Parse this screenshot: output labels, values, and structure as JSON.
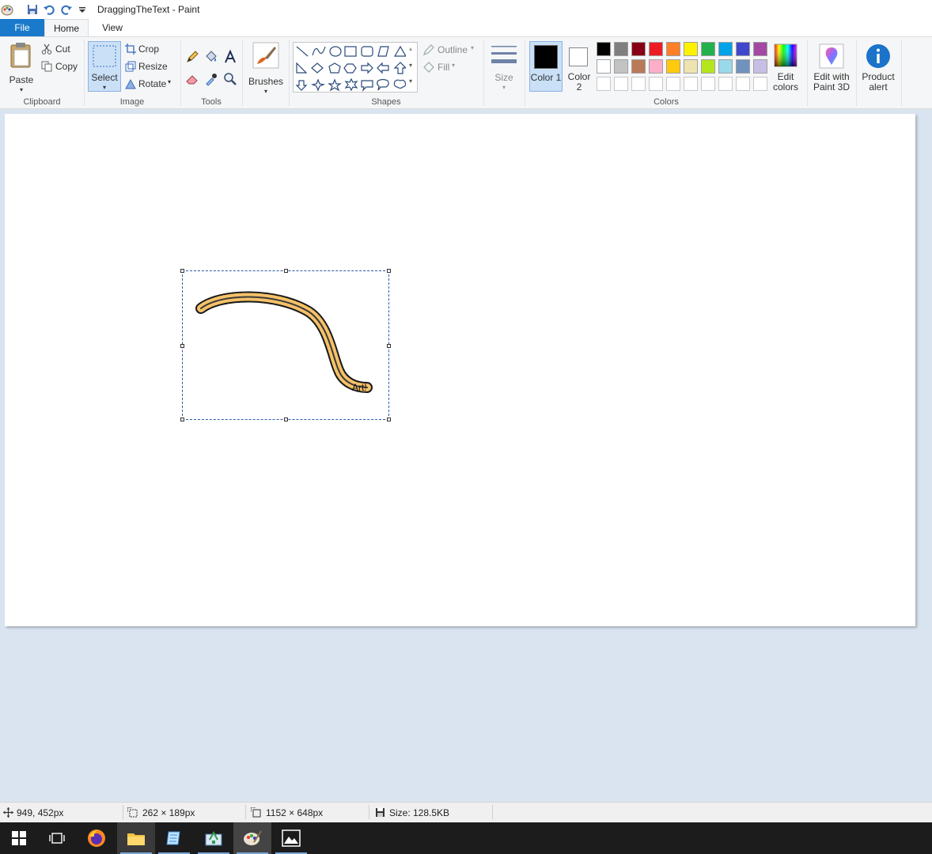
{
  "window": {
    "title": "DraggingTheText - Paint"
  },
  "tabs": [
    {
      "label": "File"
    },
    {
      "label": "Home"
    },
    {
      "label": "View"
    }
  ],
  "clipboard": {
    "paste": "Paste",
    "cut": "Cut",
    "copy": "Copy",
    "group": "Clipboard"
  },
  "image": {
    "select": "Select",
    "crop": "Crop",
    "resize": "Resize",
    "rotate": "Rotate",
    "group": "Image"
  },
  "tools": {
    "group": "Tools"
  },
  "brushes": {
    "label": "Brushes"
  },
  "shapes": {
    "outline": "Outline",
    "fill": "Fill",
    "group": "Shapes"
  },
  "size": {
    "label": "Size"
  },
  "colors": {
    "color1": "Color 1",
    "color2": "Color 2",
    "group": "Colors",
    "edit": "Edit colors",
    "row1": [
      "#000000",
      "#7f7f7f",
      "#880015",
      "#ed1c24",
      "#ff7f27",
      "#fff200",
      "#22b14c",
      "#00a2e8",
      "#3f48cc",
      "#a349a4"
    ],
    "row2": [
      "#ffffff",
      "#c3c3c3",
      "#b97a57",
      "#ffaec9",
      "#ffc90e",
      "#efe4b0",
      "#b5e61d",
      "#99d9ea",
      "#7092be",
      "#c8bfe7"
    ],
    "color1_value": "#000000",
    "color2_value": "#ffffff"
  },
  "paint3d": {
    "label": "Edit with Paint 3D"
  },
  "product_alert": {
    "label": "Product alert"
  },
  "canvas": {
    "drawing_text": "Art!"
  },
  "status": {
    "cursor": "949, 452px",
    "selection": "262 × 189px",
    "canvas_size": "1152 × 648px",
    "file_size": "Size: 128.5KB"
  },
  "taskbar": {
    "apps": [
      "start-icon",
      "task-view-icon",
      "firefox-icon",
      "file-explorer-icon",
      "notepad-icon",
      "network-app-icon",
      "paint-icon",
      "photos-icon"
    ]
  }
}
